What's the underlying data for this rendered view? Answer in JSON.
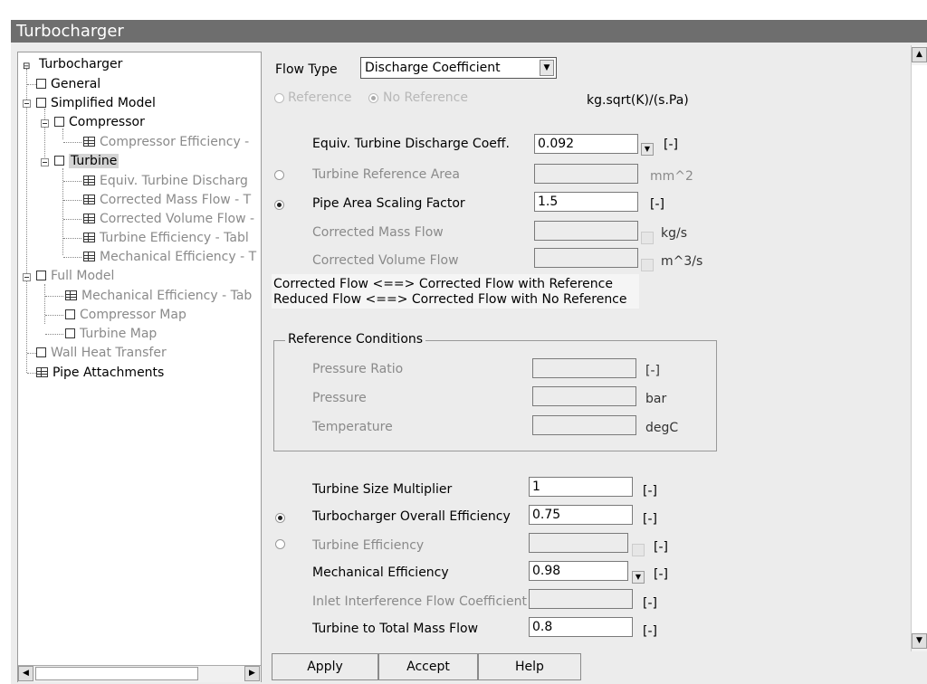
{
  "window": {
    "title": "Turbocharger"
  },
  "tree": [
    {
      "label": "Turbocharger",
      "enabled": true
    },
    {
      "label": "General",
      "enabled": true
    },
    {
      "label": "Simplified Model",
      "enabled": true
    },
    {
      "label": "Compressor",
      "enabled": true
    },
    {
      "label": "Compressor Efficiency -",
      "enabled": false
    },
    {
      "label": "Turbine",
      "enabled": true,
      "selected": true
    },
    {
      "label": "Equiv. Turbine Discharg",
      "enabled": false
    },
    {
      "label": "Corrected Mass Flow - T",
      "enabled": false
    },
    {
      "label": "Corrected Volume Flow -",
      "enabled": false
    },
    {
      "label": "Turbine Efficiency - Tabl",
      "enabled": false
    },
    {
      "label": "Mechanical Efficiency - T",
      "enabled": false
    },
    {
      "label": "Full Model",
      "enabled": false
    },
    {
      "label": "Mechanical Efficiency - Tab",
      "enabled": false
    },
    {
      "label": "Compressor Map",
      "enabled": false
    },
    {
      "label": "Turbine Map",
      "enabled": false
    },
    {
      "label": "Wall Heat Transfer",
      "enabled": false
    },
    {
      "label": "Pipe Attachments",
      "enabled": true
    }
  ],
  "flow_type": {
    "label": "Flow Type",
    "value": "Discharge Coefficient"
  },
  "reference_radio": {
    "reference": "Reference",
    "no_reference": "No Reference",
    "unit": "kg.sqrt(K)/(s.Pa)"
  },
  "rows": {
    "discharge_coeff": {
      "label": "Equiv. Turbine Discharge Coeff.",
      "value": "0.092",
      "unit": "[-]"
    },
    "ref_area": {
      "label": "Turbine Reference Area",
      "value": "",
      "unit": "mm^2"
    },
    "pipe_scaling": {
      "label": "Pipe Area Scaling Factor",
      "value": "1.5",
      "unit": "[-]"
    },
    "corr_mass_flow": {
      "label": "Corrected Mass Flow",
      "value": "",
      "unit": "kg/s"
    },
    "corr_vol_flow": {
      "label": "Corrected Volume Flow",
      "value": "",
      "unit": "m^3/s"
    }
  },
  "note": {
    "line1": "Corrected Flow <==> Corrected Flow with Reference",
    "line2": "Reduced Flow <==> Corrected Flow with No Reference"
  },
  "reference_conditions": {
    "title": "Reference Conditions",
    "pressure_ratio": {
      "label": "Pressure Ratio",
      "value": "",
      "unit": "[-]"
    },
    "pressure": {
      "label": "Pressure",
      "value": "",
      "unit": "bar"
    },
    "temperature": {
      "label": "Temperature",
      "value": "",
      "unit": "degC"
    }
  },
  "efficiency": {
    "size_multiplier": {
      "label": "Turbine Size Multiplier",
      "value": "1",
      "unit": "[-]"
    },
    "overall_eff": {
      "label": "Turbocharger Overall Efficiency",
      "value": "0.75",
      "unit": "[-]"
    },
    "turbine_eff": {
      "label": "Turbine Efficiency",
      "value": "",
      "unit": "[-]"
    },
    "mech_eff": {
      "label": "Mechanical Efficiency",
      "value": "0.98",
      "unit": "[-]"
    },
    "inlet_interf": {
      "label": "Inlet Interference Flow Coefficient",
      "value": "",
      "unit": "[-]"
    },
    "total_mass_flow": {
      "label": "Turbine to Total Mass Flow",
      "value": "0.8",
      "unit": "[-]"
    }
  },
  "buttons": {
    "apply": "Apply",
    "accept": "Accept",
    "help": "Help"
  }
}
